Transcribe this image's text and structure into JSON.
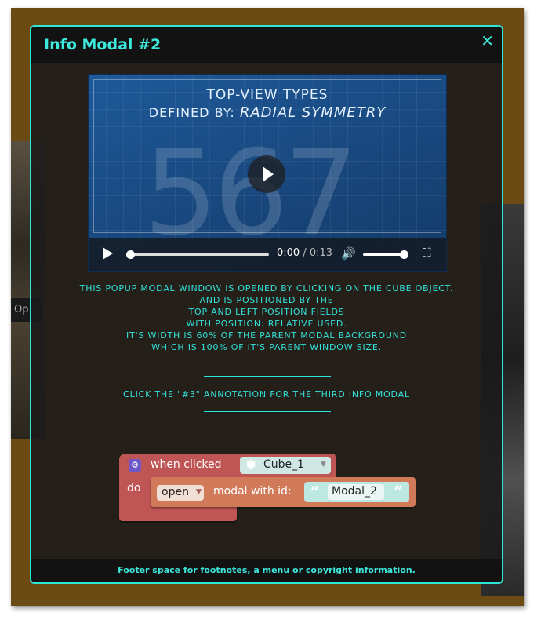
{
  "background": {
    "tab_label": "Op"
  },
  "modal": {
    "title": "Info Modal #2",
    "close_glyph": "✕"
  },
  "video": {
    "title_line1": "TOP-VIEW TYPES",
    "title_line2_prefix": "DEFINED BY:",
    "title_line2_emphasis": "RADIAL SYMMETRY",
    "digits": "567",
    "current_time": "0:00",
    "separator": "/",
    "duration": "0:13",
    "progress": 0.0,
    "volume": 1.0,
    "icons": {
      "play": "play-icon",
      "volume": "volume-icon",
      "fullscreen": "fullscreen-icon"
    }
  },
  "body": {
    "lines": [
      "This popup modal window is opened by clicking on the cube object.",
      "and is positioned by the",
      "top and left position fields",
      "with position: relative used.",
      "It's width is 60% of the parent modal background",
      "which is 100% of it's parent window size."
    ],
    "annotation_note": "Click the \"#3\" annotation for the third info modal"
  },
  "blockly": {
    "event_label": "when clicked",
    "object_field": "Cube_1",
    "do_label": "do",
    "action_dropdown": "open",
    "action_label": "modal with id:",
    "modal_id": "Modal_2",
    "quote_open": "“",
    "quote_close": "”",
    "colors": {
      "event_block": "#c05555",
      "command_block": "#d07a5a",
      "string_block": "#bde8e1"
    }
  },
  "footer": {
    "text": "Footer space for footnotes, a menu or copyright information."
  },
  "colors": {
    "accent": "#3de8dc",
    "modal_bg": "#1a1a1a"
  }
}
